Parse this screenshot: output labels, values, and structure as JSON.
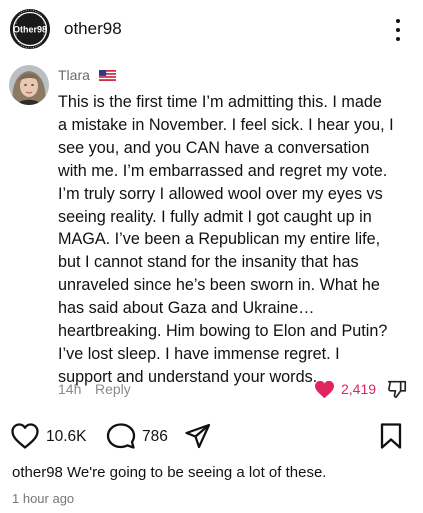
{
  "post": {
    "username": "other98",
    "logo_text": "Other98",
    "more_icon": "more-vertical-icon"
  },
  "comment": {
    "author": "Tlara",
    "flag_icon": "us-flag-icon",
    "text": "This is the first time I’m admitting this. I made\na mistake in November. I feel sick. I hear you, I\nsee you, and you CAN have a conversation\nwith me. I’m embarrassed and regret my vote.\nI’m truly sorry I allowed wool over my eyes vs\nseeing reality. I fully admit I got caught up in\nMAGA. I’ve been a Republican my entire life,\nbut I cannot stand for the insanity that has\nunraveled since he’s been sworn in. What he\nhas said about Gaza and Ukraine…\nheartbreaking. Him bowing to Elon and Putin?\nI’ve lost sleep. I have immense regret. I\nsupport and understand your words.",
    "age": "14h",
    "reply_label": "Reply",
    "like_count": "2,419",
    "liked": true
  },
  "actions": {
    "like_count": "10.6K",
    "comment_count": "786"
  },
  "caption": {
    "username": "other98",
    "text": "We're going to be seeing a lot of these.",
    "time": "1 hour ago"
  },
  "colors": {
    "heart_red": "#e0245e",
    "secondary_text": "#8a8a8a"
  }
}
